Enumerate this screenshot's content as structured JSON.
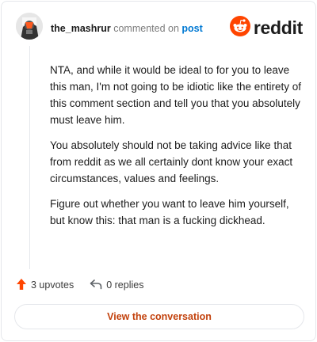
{
  "comment": {
    "author": "the_mashrur",
    "action_text": "commented on",
    "post_link": "post",
    "brand": "reddit",
    "icons": {
      "avatar": "user-avatar-icon",
      "logo": "reddit-logo-icon",
      "upvote": "upvote-arrow-icon",
      "reply": "reply-arrow-icon"
    },
    "paragraphs": [
      "NTA, and while it would be ideal to for you to leave this man, I'm not going to be idiotic like the entirety of this comment section and tell you that you absolutely must leave him.",
      "You absolutely should not be taking advice like that from reddit as we all certainly dont know your exact circumstances, values and feelings.",
      "Figure out whether you want to leave him yourself, but know this: that man is a fucking dickhead."
    ],
    "upvotes_label": "3 upvotes",
    "replies_label": "0 replies",
    "view_conversation_label": "View the conversation"
  },
  "colors": {
    "brand_orange": "#ff4500",
    "link_blue": "#0079d3",
    "button_text": "#c2410c"
  }
}
